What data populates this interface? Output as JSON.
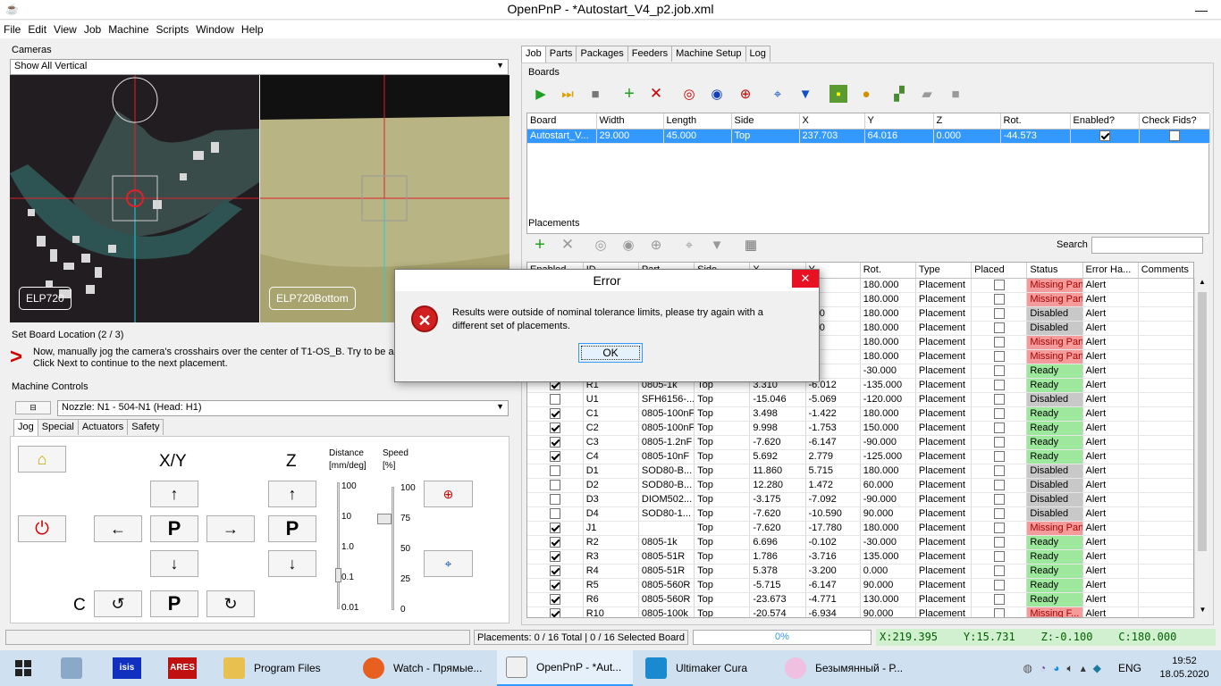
{
  "window": {
    "title": "OpenPnP - *Autostart_V4_p2.job.xml"
  },
  "menu": [
    "File",
    "Edit",
    "View",
    "Job",
    "Machine",
    "Scripts",
    "Window",
    "Help"
  ],
  "cameras": {
    "label": "Cameras",
    "view_select": "Show All Vertical",
    "left_name": "ELP720",
    "right_name": "ELP720Bottom"
  },
  "set_board": {
    "title": "Set Board Location (2 / 3)",
    "instructions": "Now, manually jog the camera's crosshairs over the center of T1-OS_B. Try to be as precise as possible. Click Next to continue to the next placement."
  },
  "machine_controls": {
    "label": "Machine Controls",
    "collapse": "⊟",
    "nozzle": "Nozzle: N1 - 504-N1 (Head: H1)",
    "tabs": [
      "Jog",
      "Special",
      "Actuators",
      "Safety"
    ],
    "xy_label": "X/Y",
    "z_label": "Z",
    "c_label": "C",
    "park": "P",
    "distance_label": "Distance",
    "distance_unit": "[mm/deg]",
    "speed_label": "Speed",
    "speed_unit": "[%]",
    "distance_ticks": [
      "100",
      "10",
      "1.0",
      "0.1",
      "0.01"
    ],
    "speed_ticks": [
      "100",
      "75",
      "50",
      "25",
      "0"
    ]
  },
  "right_tabs": [
    "Job",
    "Parts",
    "Packages",
    "Feeders",
    "Machine Setup",
    "Log"
  ],
  "boards": {
    "label": "Boards",
    "columns": [
      "Board",
      "Width",
      "Length",
      "Side",
      "X",
      "Y",
      "Z",
      "Rot.",
      "Enabled?",
      "Check Fids?"
    ],
    "rows": [
      {
        "board": "Autostart_V...",
        "width": "29.000",
        "length": "45.000",
        "side": "Top",
        "x": "237.703",
        "y": "64.016",
        "z": "0.000",
        "rot": "-44.573",
        "enabled": true,
        "check": false
      }
    ]
  },
  "placements": {
    "label": "Placements",
    "search_label": "Search",
    "search_value": "",
    "columns": [
      "Enabled",
      "ID",
      "Part",
      "Side",
      "X",
      "Y",
      "Rot.",
      "Type",
      "Placed",
      "Status",
      "Error Ha...",
      "Comments"
    ],
    "rows": [
      {
        "en": true,
        "id": "",
        "part": "",
        "side": "",
        "x": "",
        "y": "0",
        "rot": "180.000",
        "type": "Placement",
        "placed": false,
        "status": "Missing Part",
        "err": "Alert",
        "cls": "missing"
      },
      {
        "en": true,
        "id": "",
        "part": "",
        "side": "",
        "x": "",
        "y": "51",
        "rot": "180.000",
        "type": "Placement",
        "placed": false,
        "status": "Missing Part",
        "err": "Alert",
        "cls": "missing"
      },
      {
        "en": false,
        "id": "",
        "part": "",
        "side": "",
        "x": "",
        "y": "430",
        "rot": "180.000",
        "type": "Placement",
        "placed": false,
        "status": "Disabled",
        "err": "Alert",
        "cls": "disabled"
      },
      {
        "en": false,
        "id": "",
        "part": "",
        "side": "",
        "x": "",
        "y": "430",
        "rot": "180.000",
        "type": "Placement",
        "placed": false,
        "status": "Disabled",
        "err": "Alert",
        "cls": "disabled"
      },
      {
        "en": true,
        "id": "",
        "part": "",
        "side": "",
        "x": "",
        "y": "53",
        "rot": "180.000",
        "type": "Placement",
        "placed": false,
        "status": "Missing Part",
        "err": "Alert",
        "cls": "missing"
      },
      {
        "en": true,
        "id": "",
        "part": "",
        "side": "",
        "x": "",
        "y": "90",
        "rot": "180.000",
        "type": "Placement",
        "placed": false,
        "status": "Missing Part",
        "err": "Alert",
        "cls": "missing"
      },
      {
        "en": true,
        "id": "",
        "part": "",
        "side": "",
        "x": "",
        "y": "7",
        "rot": "-30.000",
        "type": "Placement",
        "placed": false,
        "status": "Ready",
        "err": "Alert",
        "cls": "ready"
      },
      {
        "en": true,
        "id": "R1",
        "part": "0805-1k",
        "side": "Top",
        "x": "3.310",
        "y": "-6.012",
        "rot": "-135.000",
        "type": "Placement",
        "placed": false,
        "status": "Ready",
        "err": "Alert",
        "cls": "ready"
      },
      {
        "en": false,
        "id": "U1",
        "part": "SFH6156-...",
        "side": "Top",
        "x": "-15.046",
        "y": "-5.069",
        "rot": "-120.000",
        "type": "Placement",
        "placed": false,
        "status": "Disabled",
        "err": "Alert",
        "cls": "disabled"
      },
      {
        "en": true,
        "id": "C1",
        "part": "0805-100nF",
        "side": "Top",
        "x": "3.498",
        "y": "-1.422",
        "rot": "180.000",
        "type": "Placement",
        "placed": false,
        "status": "Ready",
        "err": "Alert",
        "cls": "ready"
      },
      {
        "en": true,
        "id": "C2",
        "part": "0805-100nF",
        "side": "Top",
        "x": "9.998",
        "y": "-1.753",
        "rot": "150.000",
        "type": "Placement",
        "placed": false,
        "status": "Ready",
        "err": "Alert",
        "cls": "ready"
      },
      {
        "en": true,
        "id": "C3",
        "part": "0805-1.2nF",
        "side": "Top",
        "x": "-7.620",
        "y": "-6.147",
        "rot": "-90.000",
        "type": "Placement",
        "placed": false,
        "status": "Ready",
        "err": "Alert",
        "cls": "ready"
      },
      {
        "en": true,
        "id": "C4",
        "part": "0805-10nF",
        "side": "Top",
        "x": "5.692",
        "y": "2.779",
        "rot": "-125.000",
        "type": "Placement",
        "placed": false,
        "status": "Ready",
        "err": "Alert",
        "cls": "ready"
      },
      {
        "en": false,
        "id": "D1",
        "part": "SOD80-B...",
        "side": "Top",
        "x": "11.860",
        "y": "5.715",
        "rot": "180.000",
        "type": "Placement",
        "placed": false,
        "status": "Disabled",
        "err": "Alert",
        "cls": "disabled"
      },
      {
        "en": false,
        "id": "D2",
        "part": "SOD80-B...",
        "side": "Top",
        "x": "12.280",
        "y": "1.472",
        "rot": "60.000",
        "type": "Placement",
        "placed": false,
        "status": "Disabled",
        "err": "Alert",
        "cls": "disabled"
      },
      {
        "en": false,
        "id": "D3",
        "part": "DIOM502...",
        "side": "Top",
        "x": "-3.175",
        "y": "-7.092",
        "rot": "-90.000",
        "type": "Placement",
        "placed": false,
        "status": "Disabled",
        "err": "Alert",
        "cls": "disabled"
      },
      {
        "en": false,
        "id": "D4",
        "part": "SOD80-1...",
        "side": "Top",
        "x": "-7.620",
        "y": "-10.590",
        "rot": "90.000",
        "type": "Placement",
        "placed": false,
        "status": "Disabled",
        "err": "Alert",
        "cls": "disabled"
      },
      {
        "en": true,
        "id": "J1",
        "part": "",
        "side": "Top",
        "x": "-7.620",
        "y": "-17.780",
        "rot": "180.000",
        "type": "Placement",
        "placed": false,
        "status": "Missing Part",
        "err": "Alert",
        "cls": "missing"
      },
      {
        "en": true,
        "id": "R2",
        "part": "0805-1k",
        "side": "Top",
        "x": "6.696",
        "y": "-0.102",
        "rot": "-30.000",
        "type": "Placement",
        "placed": false,
        "status": "Ready",
        "err": "Alert",
        "cls": "ready"
      },
      {
        "en": true,
        "id": "R3",
        "part": "0805-51R",
        "side": "Top",
        "x": "1.786",
        "y": "-3.716",
        "rot": "135.000",
        "type": "Placement",
        "placed": false,
        "status": "Ready",
        "err": "Alert",
        "cls": "ready"
      },
      {
        "en": true,
        "id": "R4",
        "part": "0805-51R",
        "side": "Top",
        "x": "5.378",
        "y": "-3.200",
        "rot": "0.000",
        "type": "Placement",
        "placed": false,
        "status": "Ready",
        "err": "Alert",
        "cls": "ready"
      },
      {
        "en": true,
        "id": "R5",
        "part": "0805-560R",
        "side": "Top",
        "x": "-5.715",
        "y": "-6.147",
        "rot": "90.000",
        "type": "Placement",
        "placed": false,
        "status": "Ready",
        "err": "Alert",
        "cls": "ready"
      },
      {
        "en": true,
        "id": "R6",
        "part": "0805-560R",
        "side": "Top",
        "x": "-23.673",
        "y": "-4.771",
        "rot": "130.000",
        "type": "Placement",
        "placed": false,
        "status": "Ready",
        "err": "Alert",
        "cls": "ready"
      },
      {
        "en": true,
        "id": "R10",
        "part": "0805-100k",
        "side": "Top",
        "x": "-20.574",
        "y": "-6.934",
        "rot": "90.000",
        "type": "Placement",
        "placed": false,
        "status": "Missing F...",
        "err": "Alert",
        "cls": "missing"
      }
    ]
  },
  "status_bar": {
    "placements": "Placements: 0 / 16 Total | 0 / 16 Selected Board",
    "progress": "0%",
    "progress_value": 0,
    "dro": "X:219.395    Y:15.731    Z:-0.100    C:180.000"
  },
  "dialog": {
    "title": "Error",
    "message": "Results were outside of nominal tolerance limits, please try again with a different set of placements.",
    "ok": "OK"
  },
  "taskbar": {
    "apps": [
      {
        "label": "Program Files"
      },
      {
        "label": "Watch - Прямые..."
      },
      {
        "label": "OpenPnP - *Aut..."
      },
      {
        "label": "Ultimaker Cura"
      },
      {
        "label": "Безымянный - Р..."
      }
    ],
    "lang": "ENG",
    "time": "19:52",
    "date": "18.05.2020"
  },
  "colors": {
    "accent": "#3399ff",
    "missing": "#f49b9b",
    "ready": "#9de89d",
    "disabled": "#c8c8c8",
    "dro_bg": "#d0f0d0",
    "dro_fg": "#006000"
  }
}
